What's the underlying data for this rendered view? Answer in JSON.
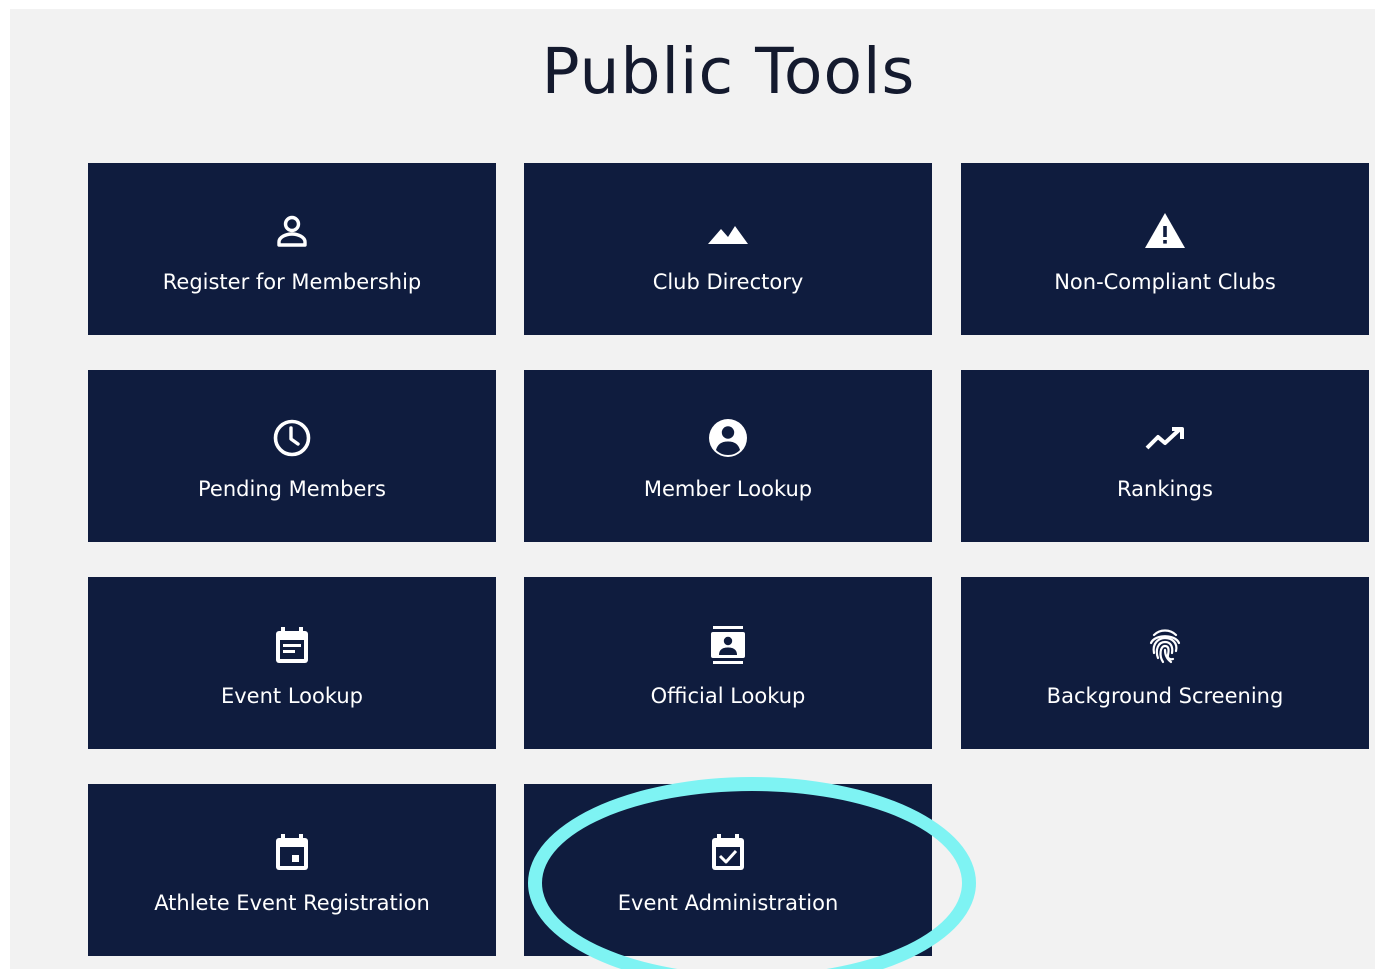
{
  "page": {
    "title": "Public Tools"
  },
  "tiles": [
    {
      "label": "Register for Membership",
      "icon": "person-outline-icon"
    },
    {
      "label": "Club Directory",
      "icon": "landscape-icon"
    },
    {
      "label": "Non-Compliant Clubs",
      "icon": "warning-icon"
    },
    {
      "label": "Pending Members",
      "icon": "clock-icon"
    },
    {
      "label": "Member Lookup",
      "icon": "account-circle-icon"
    },
    {
      "label": "Rankings",
      "icon": "trending-up-icon"
    },
    {
      "label": "Event Lookup",
      "icon": "calendar-notes-icon"
    },
    {
      "label": "Official Lookup",
      "icon": "contact-badge-icon"
    },
    {
      "label": "Background Screening",
      "icon": "fingerprint-icon"
    },
    {
      "label": "Athlete Event Registration",
      "icon": "calendar-event-icon"
    },
    {
      "label": "Event Administration",
      "icon": "calendar-check-icon"
    }
  ],
  "annotation": {
    "highlighted_tile": "Event Administration",
    "ring_color": "#7ef3f3"
  },
  "colors": {
    "tile_background": "#0f1c3e",
    "page_background": "#f2f2f2",
    "title_text": "#141a2e"
  }
}
